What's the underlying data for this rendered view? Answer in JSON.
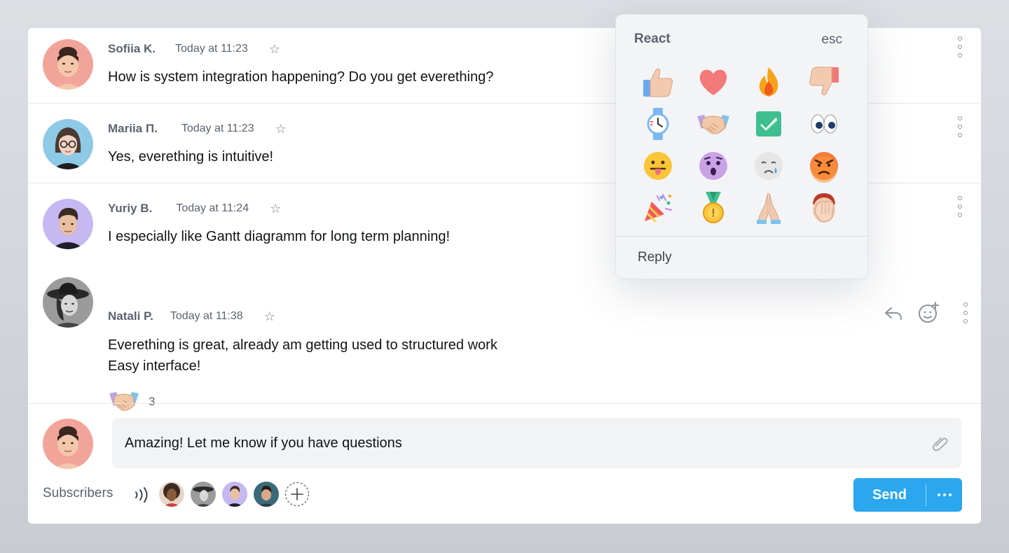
{
  "messages": [
    {
      "author": "Sofiia K.",
      "time": "Today at 11:23",
      "text": "How is system integration happening? Do you get everething?"
    },
    {
      "author": "Mariia П.",
      "time": "Today at 11:23",
      "text": "Yes, everething is intuitive!"
    },
    {
      "author": "Yuriy B.",
      "time": "Today at 11:24",
      "text": "I especially like Gantt diagramm for long term planning!"
    },
    {
      "author": "Natali P.",
      "time": "Today at 11:38",
      "text_line1": "Everething is great, already am getting used to structured work",
      "text_line2": "Easy interface!",
      "reaction": {
        "icon": "handshake-icon",
        "count": "3"
      }
    }
  ],
  "composer": {
    "value": "Amazing! Let me know if you have questions",
    "subscribers_label": "Subscribers",
    "send_label": "Send"
  },
  "react_popup": {
    "title": "React",
    "esc": "esc",
    "reply": "Reply",
    "emojis": [
      "thumbs-up",
      "heart",
      "fire",
      "thumbs-down",
      "watch",
      "handshake",
      "check-mark",
      "eyes",
      "tongue-face",
      "astonished-face",
      "crying-face",
      "angry-face",
      "party-popper",
      "medal",
      "folded-hands",
      "face-palm"
    ]
  },
  "colors": {
    "accent": "#2aa7ee",
    "muted_text": "#5b6370",
    "input_bg": "#f2f3f5"
  }
}
